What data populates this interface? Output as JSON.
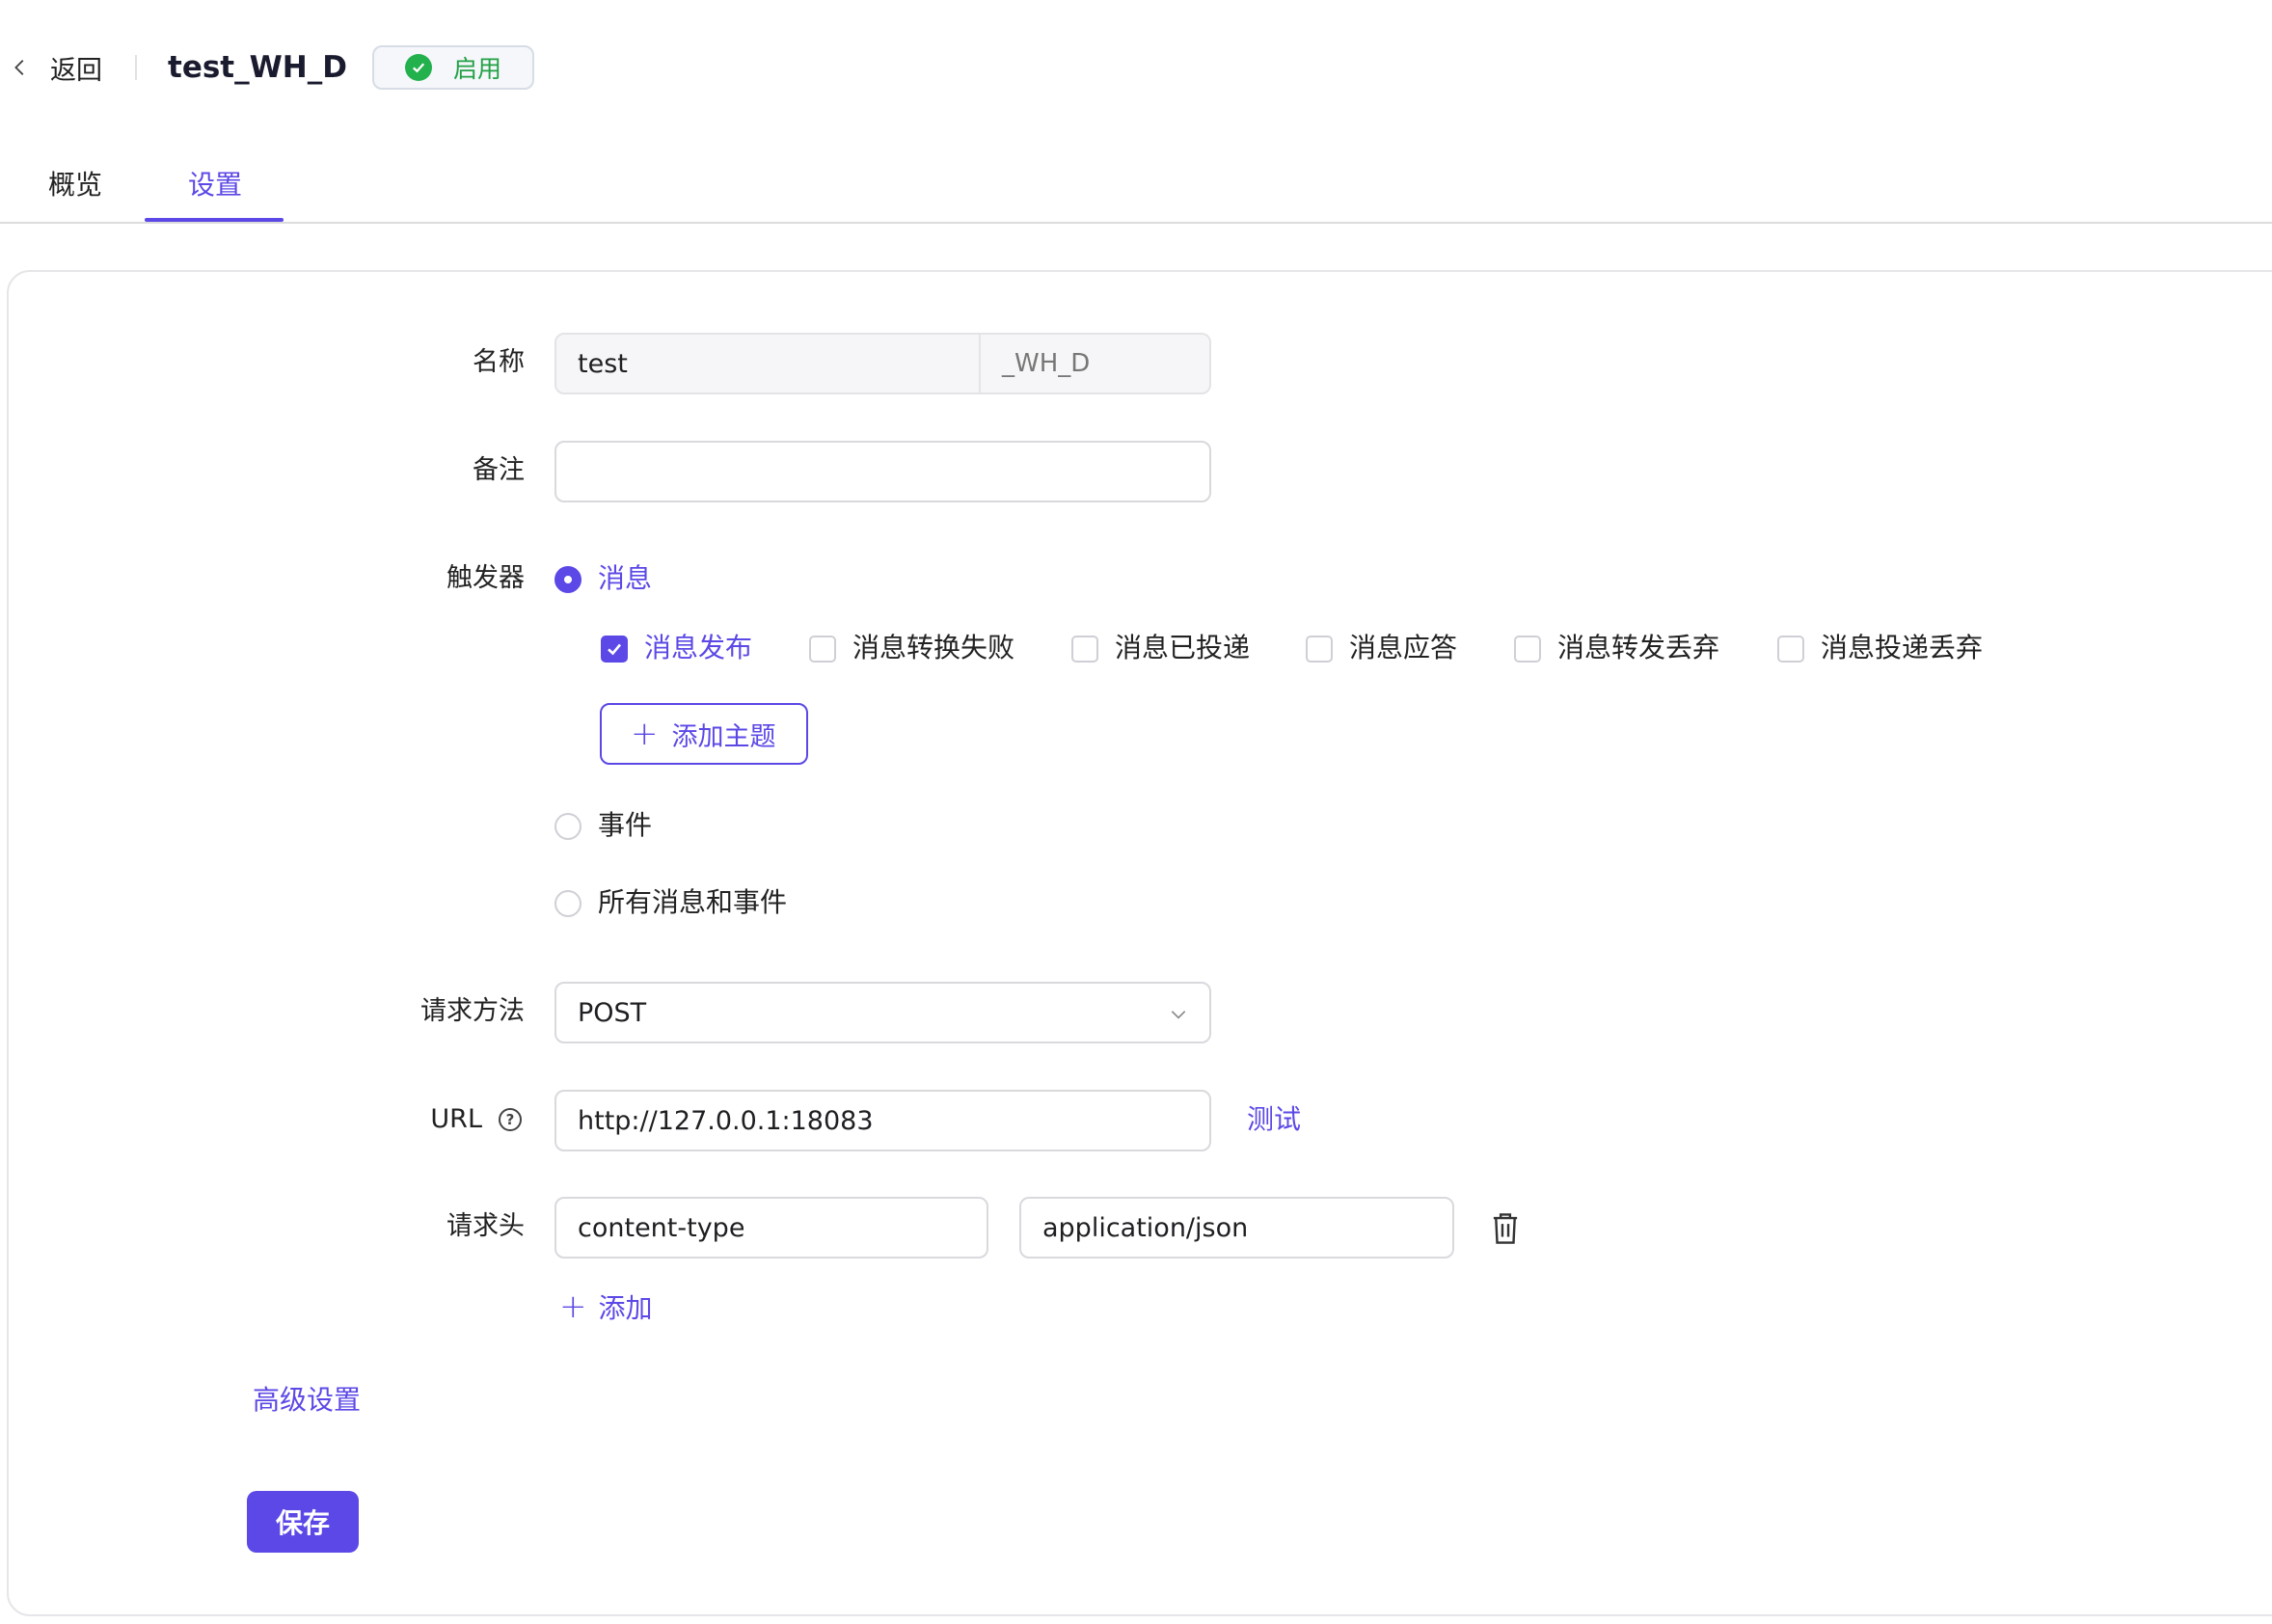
{
  "header": {
    "back_label": "返回",
    "title": "test_WH_D",
    "status": "启用"
  },
  "tabs": [
    {
      "label": "概览",
      "active": false
    },
    {
      "label": "设置",
      "active": true
    }
  ],
  "form": {
    "name": {
      "label": "名称",
      "value": "test",
      "suffix": "_WH_D"
    },
    "remark": {
      "label": "备注",
      "value": ""
    },
    "trigger": {
      "label": "触发器",
      "options": [
        {
          "label": "消息",
          "selected": true
        },
        {
          "label": "事件",
          "selected": false
        },
        {
          "label": "所有消息和事件",
          "selected": false
        }
      ],
      "message_types": [
        {
          "label": "消息发布",
          "checked": true
        },
        {
          "label": "消息转换失败",
          "checked": false
        },
        {
          "label": "消息已投递",
          "checked": false
        },
        {
          "label": "消息应答",
          "checked": false
        },
        {
          "label": "消息转发丢弃",
          "checked": false
        },
        {
          "label": "消息投递丢弃",
          "checked": false
        }
      ],
      "add_topic_label": "添加主题"
    },
    "method": {
      "label": "请求方法",
      "value": "POST"
    },
    "url": {
      "label": "URL",
      "value": "http://127.0.0.1:18083",
      "test_label": "测试"
    },
    "headers": {
      "label": "请求头",
      "rows": [
        {
          "key": "content-type",
          "value": "application/json"
        }
      ],
      "add_label": "添加"
    },
    "advanced_label": "高级设置",
    "save_label": "保存"
  },
  "colors": {
    "accent": "#5b48e6",
    "success": "#22b14c"
  }
}
